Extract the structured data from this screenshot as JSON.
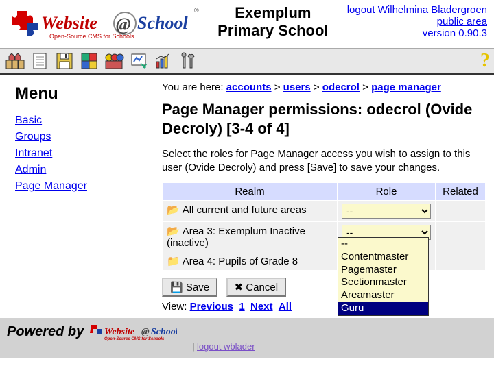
{
  "header": {
    "title1": "Exemplum",
    "title2": "Primary School",
    "logout_label": "logout Wilhelmina Bladergroen",
    "public_area_label": "public area",
    "version": "version 0.90.3"
  },
  "menu": {
    "heading": "Menu",
    "items": [
      {
        "label": "Basic"
      },
      {
        "label": "Groups"
      },
      {
        "label": "Intranet"
      },
      {
        "label": "Admin"
      },
      {
        "label": "Page Manager",
        "active": true
      }
    ]
  },
  "breadcrumb": {
    "prefix": "You are here: ",
    "parts": [
      "accounts",
      "users",
      "odecrol",
      "page manager"
    ]
  },
  "page_title": "Page Manager permissions: odecrol (Ovide Decroly) [3-4 of 4]",
  "description": "Select the roles for Page Manager access you wish to assign to this user (Ovide Decroly) and press [Save] to save your changes.",
  "table": {
    "headers": [
      "Realm",
      "Role",
      "Related"
    ],
    "rows": [
      {
        "realm": "All current and future areas",
        "role": "--"
      },
      {
        "realm": "Area 3: Exemplum Inactive (inactive)",
        "role": "--",
        "dropdown_open": true
      },
      {
        "realm": "Area 4: Pupils of Grade 8",
        "role": ""
      }
    ]
  },
  "role_options": [
    "--",
    "Contentmaster",
    "Pagemaster",
    "Sectionmaster",
    "Areamaster",
    "Guru"
  ],
  "selected_option": "Guru",
  "buttons": {
    "save": "Save",
    "cancel": "Cancel"
  },
  "pager": {
    "label": "View:",
    "prev": "Previous",
    "page": "1",
    "next": "Next",
    "all": "All"
  },
  "footer": {
    "powered": "Powered by",
    "logout": "logout wblader",
    "sep": "|"
  }
}
